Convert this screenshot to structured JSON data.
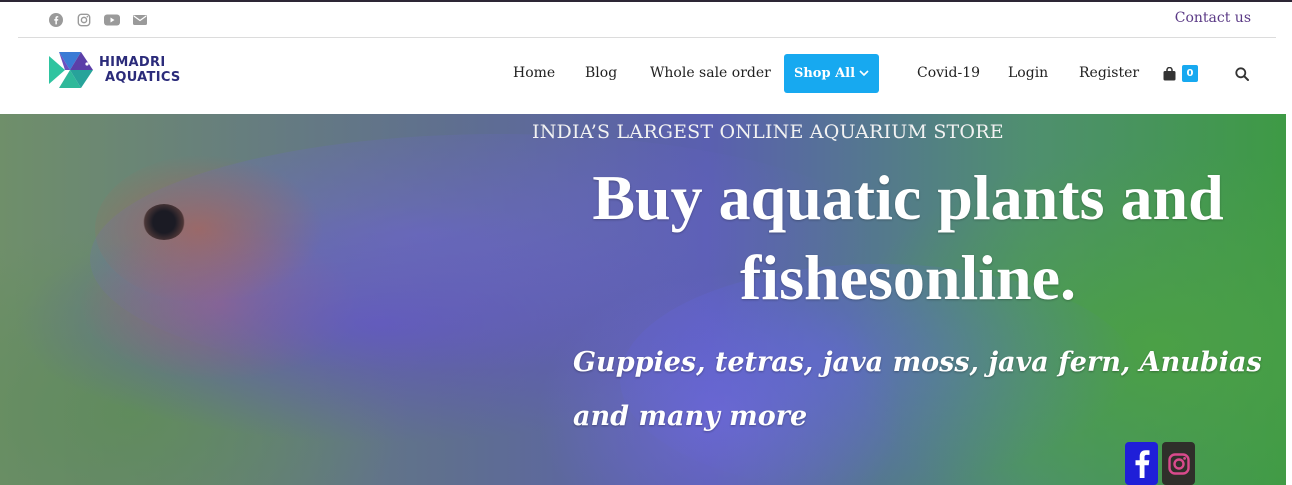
{
  "topbar": {
    "social_icons": [
      "facebook-icon",
      "instagram-icon",
      "youtube-icon",
      "envelope-icon"
    ],
    "contact_label": "Contact us"
  },
  "logo": {
    "line1": "HIMADRI",
    "line2": "AQUATICS"
  },
  "nav": {
    "items": [
      "Home",
      "Blog",
      "Whole sale order"
    ],
    "shop_all": "Shop All",
    "covid": "Covid-19",
    "login": "Login",
    "register": "Register",
    "cart_count": "0"
  },
  "hero": {
    "kicker": "INDIA’S LARGEST ONLINE AQUARIUM STORE",
    "title": "Buy aquatic plants and fishesonline.",
    "subtitle": "Guppies, tetras, java moss, java fern, Anubias and many more"
  },
  "floating_social": [
    "facebook-icon",
    "instagram-icon"
  ],
  "colors": {
    "accent": "#17a9f0",
    "contact_link": "#5b3a86",
    "logo_text": "#2b2b7a",
    "facebook": "#1f1fd8"
  }
}
